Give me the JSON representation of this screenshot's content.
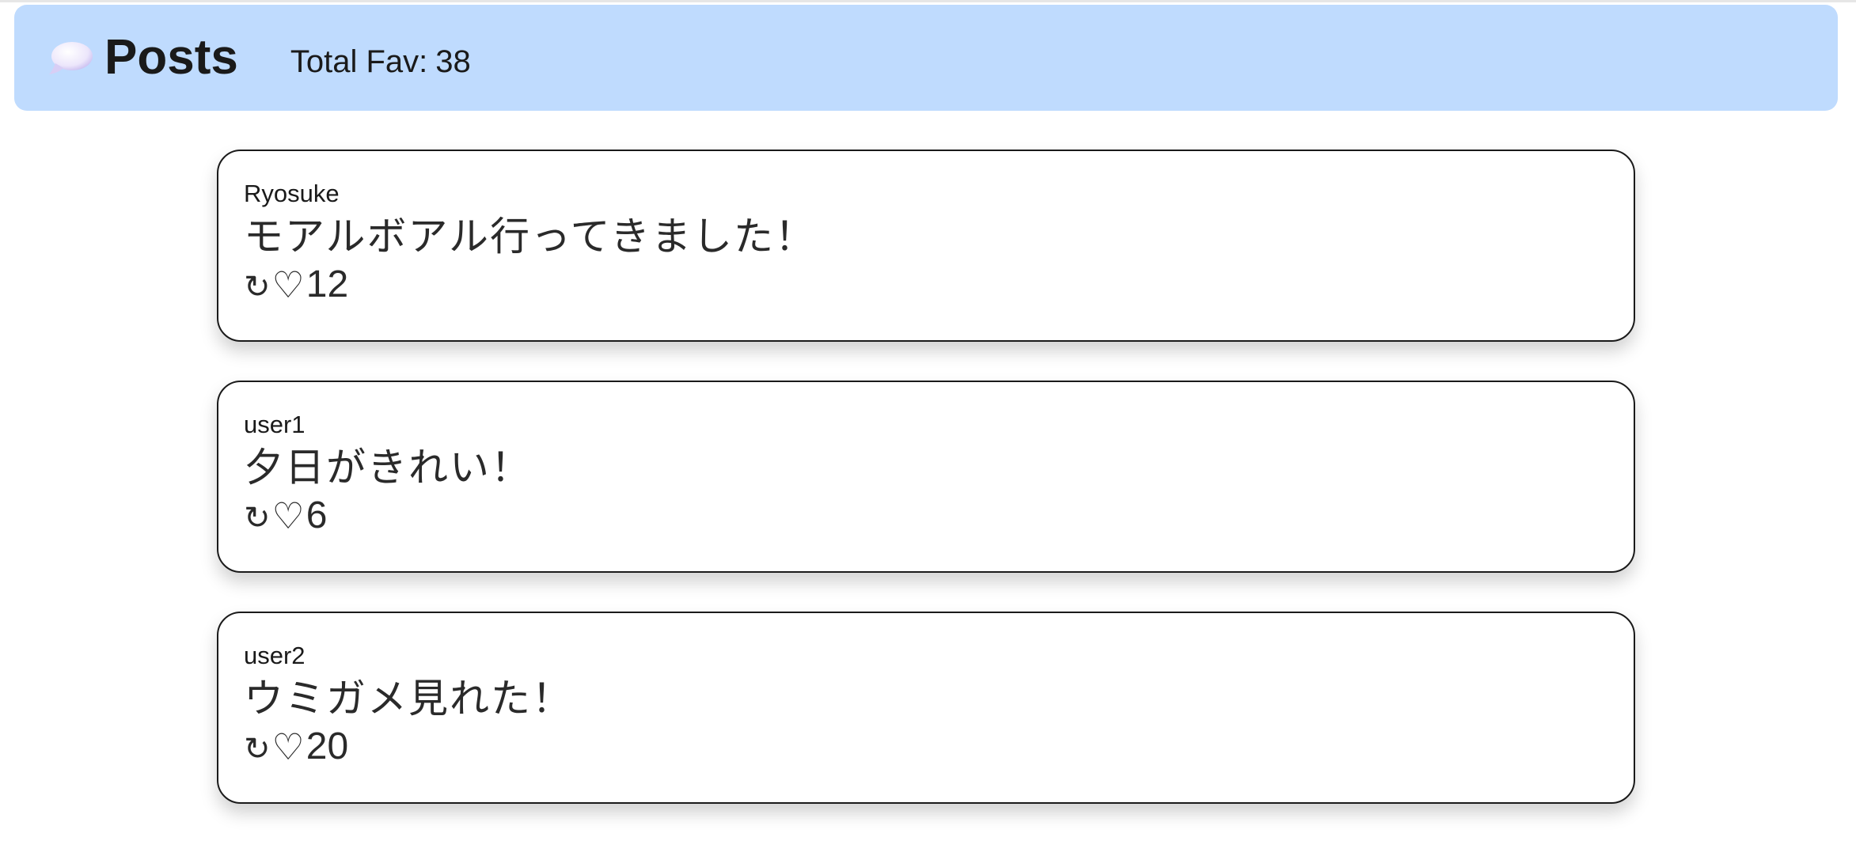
{
  "header": {
    "icon": "speech-bubble-icon",
    "title": "Posts",
    "total_fav_label": "Total Fav:",
    "total_fav_value": "38",
    "background_color": "#bfdbfe"
  },
  "posts": [
    {
      "user": "Ryosuke",
      "text": "モアルボアル行ってきました！",
      "retweet_glyph": "↻",
      "heart_glyph": "♡",
      "fav_count": "12"
    },
    {
      "user": "user1",
      "text": "夕日がきれい！",
      "retweet_glyph": "↻",
      "heart_glyph": "♡",
      "fav_count": "6"
    },
    {
      "user": "user2",
      "text": "ウミガメ見れた！",
      "retweet_glyph": "↻",
      "heart_glyph": "♡",
      "fav_count": "20"
    }
  ]
}
